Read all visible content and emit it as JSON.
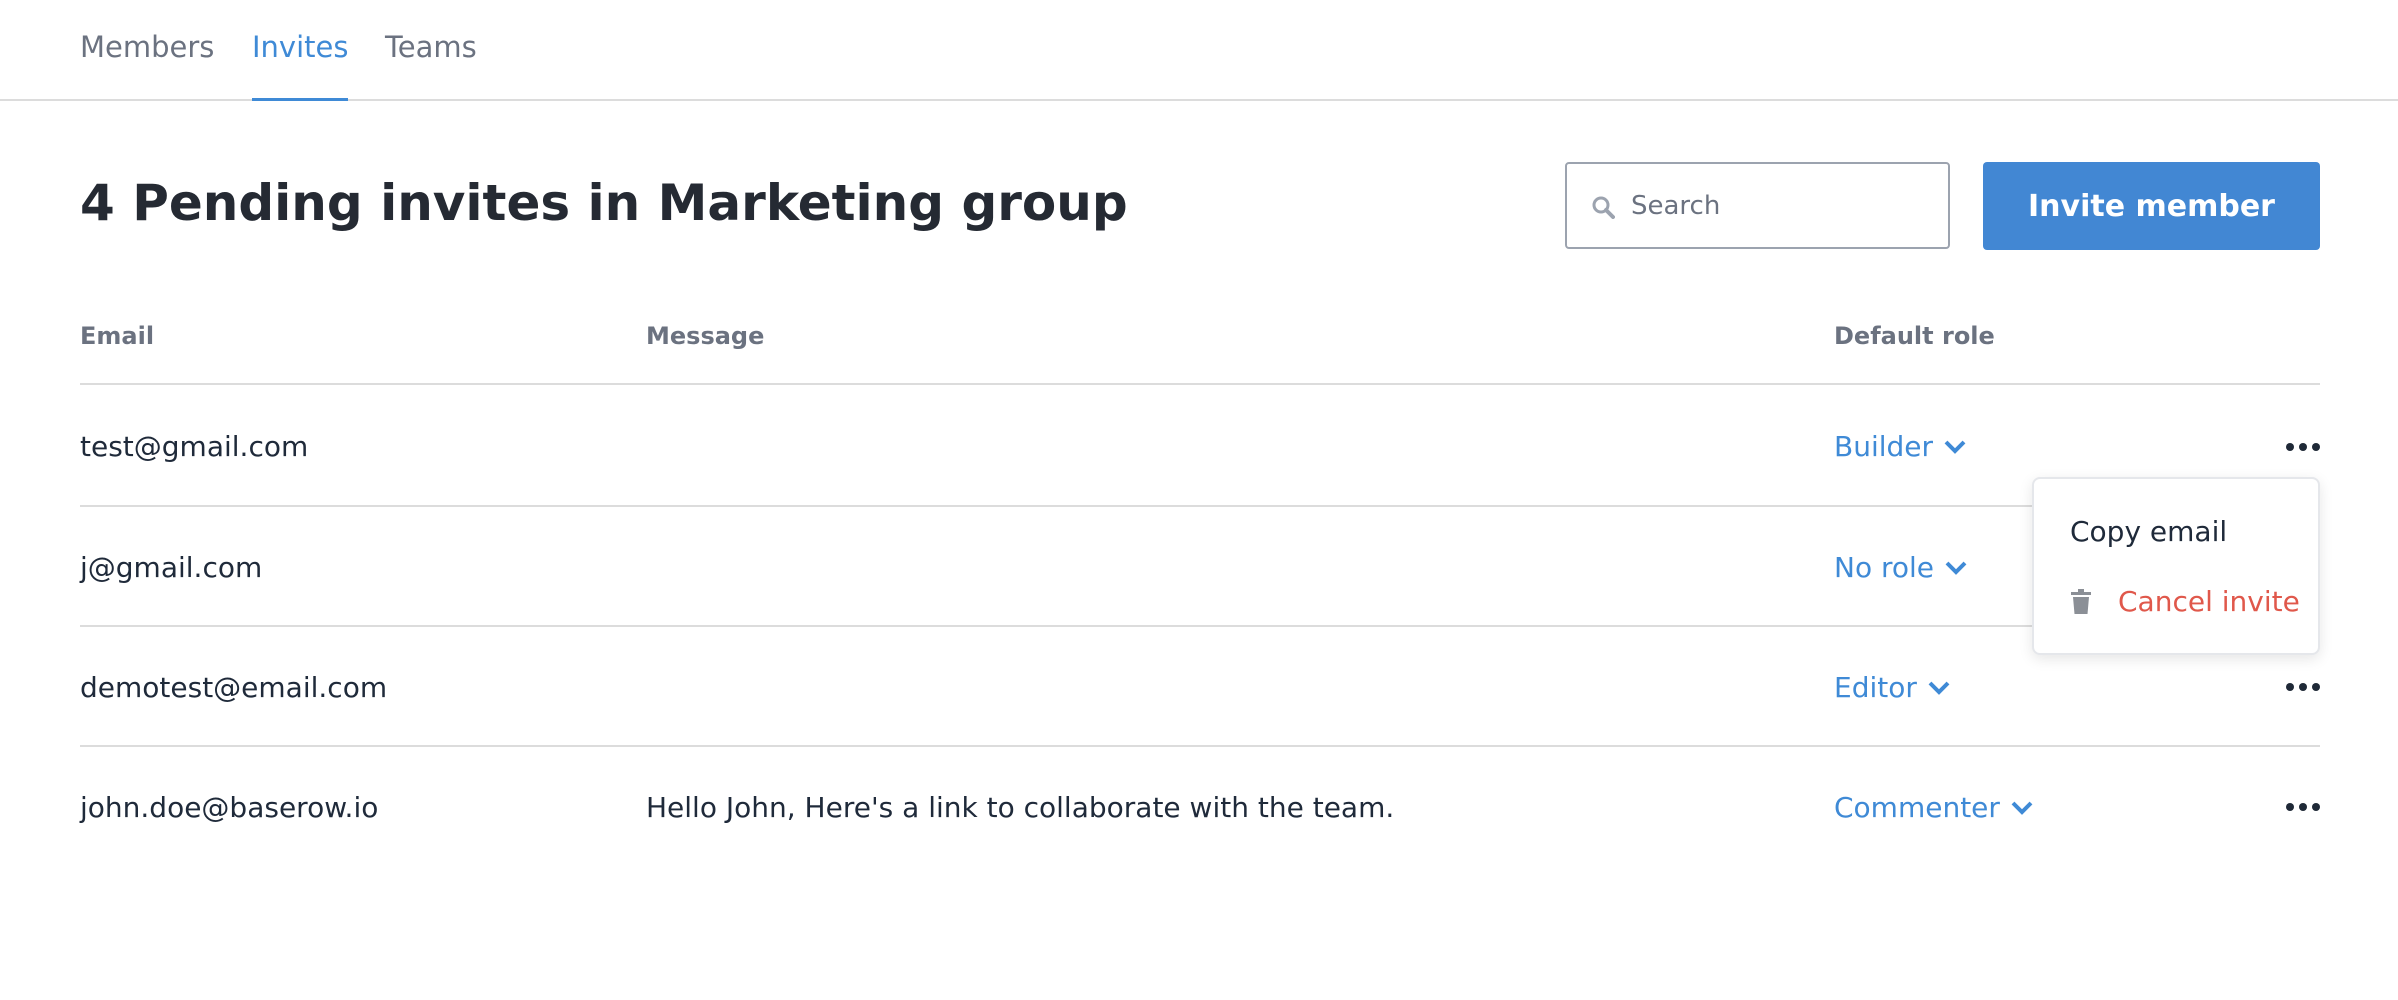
{
  "tabs": [
    {
      "label": "Members",
      "active": false
    },
    {
      "label": "Invites",
      "active": true
    },
    {
      "label": "Teams",
      "active": false
    }
  ],
  "header": {
    "title": "4 Pending invites in Marketing group",
    "search_placeholder": "Search",
    "invite_button": "Invite member"
  },
  "table": {
    "columns": [
      "Email",
      "Message",
      "Default role"
    ],
    "rows": [
      {
        "email": "test@gmail.com",
        "message": "",
        "role": "Builder"
      },
      {
        "email": "j@gmail.com",
        "message": "",
        "role": "No role"
      },
      {
        "email": "demotest@email.com",
        "message": "",
        "role": "Editor"
      },
      {
        "email": "john.doe@baserow.io",
        "message": "Hello John, Here's a link to collaborate with the team.",
        "role": "Commenter"
      }
    ]
  },
  "context_menu": {
    "copy_email": "Copy email",
    "cancel_invite": "Cancel invite"
  },
  "icons": {
    "search": "search-icon",
    "more": "more-horizontal-icon",
    "dropdown": "chevron-down-icon",
    "trash": "trash-icon"
  },
  "colors": {
    "accent": "#4287d3",
    "link": "#3f8ad6",
    "danger": "#e0584b"
  }
}
